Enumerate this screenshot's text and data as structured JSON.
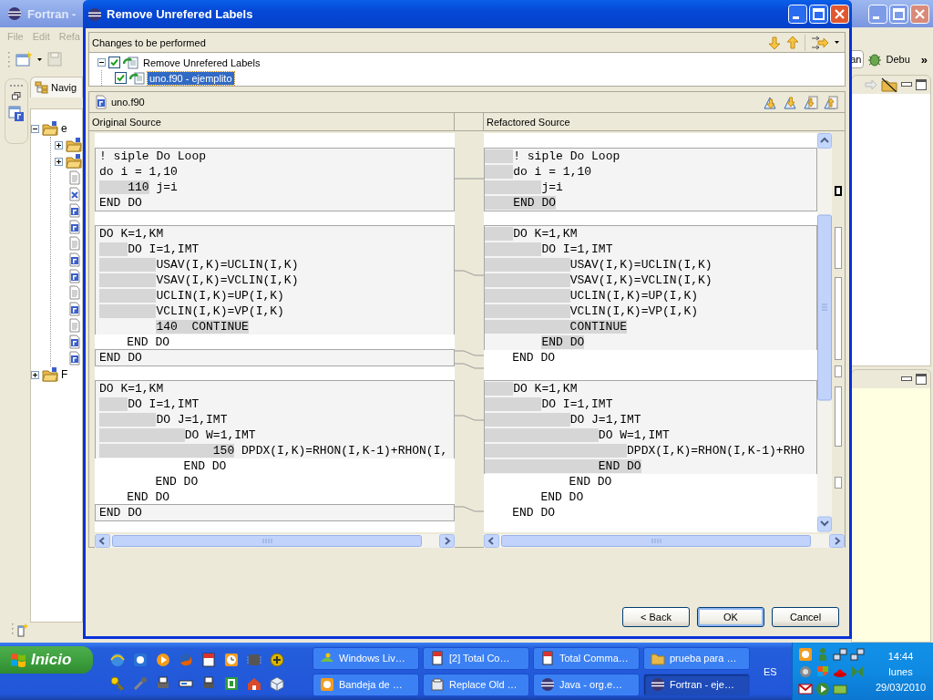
{
  "background_window": {
    "title": "Fortran -",
    "menu": [
      "File",
      "Edit",
      "Refa"
    ],
    "navigator_tab": "Navig",
    "tree": [
      {
        "label": "e",
        "expanded": true,
        "children": [
          {
            "kind": "folder",
            "expanded": false
          },
          {
            "kind": "folder",
            "expanded": false
          },
          {
            "kind": "text-file"
          },
          {
            "kind": "x-file"
          },
          {
            "kind": "fortran-file"
          },
          {
            "kind": "fortran-file"
          },
          {
            "kind": "text-file"
          },
          {
            "kind": "fortran-file"
          },
          {
            "kind": "fortran-file"
          },
          {
            "kind": "text-file"
          },
          {
            "kind": "fortran-file"
          },
          {
            "kind": "text-file"
          },
          {
            "kind": "fortran-file"
          },
          {
            "kind": "fortran-file"
          }
        ]
      },
      {
        "label": "F",
        "expanded": false
      }
    ],
    "perspectives": [
      "an",
      "Debu"
    ],
    "more": "»"
  },
  "dialog": {
    "title": "Remove Unrefered Labels",
    "changes_header": "Changes to be performed",
    "changes": [
      {
        "label": "Remove Unrefered Labels",
        "checked": true,
        "expanded": true,
        "children": [
          {
            "label": "uno.f90 - ejemplito",
            "checked": true,
            "selected": true
          }
        ]
      }
    ],
    "file": "uno.f90",
    "left_title": "Original Source",
    "right_title": "Refactored Source",
    "left": [
      {
        "kind": "gap"
      },
      {
        "kind": "changed",
        "lines": [
          {
            "text": "! siple Do Loop",
            "kind": "plain"
          },
          {
            "text": "do i = 1,10",
            "kind": "plain"
          },
          {
            "text": "    110 j=i",
            "kind": "label"
          },
          {
            "text": "END DO",
            "kind": "plain"
          }
        ]
      },
      {
        "kind": "gap"
      },
      {
        "kind": "changed",
        "lines": [
          {
            "text": "DO K=1,KM",
            "kind": "plain"
          },
          {
            "text": "    DO I=1,IMT",
            "kind": "indent"
          },
          {
            "text": "        USAV(I,K)=UCLIN(I,K)",
            "kind": "indent"
          },
          {
            "text": "        VSAV(I,K)=VCLIN(I,K)",
            "kind": "indent"
          },
          {
            "text": "        UCLIN(I,K)=UP(I,K)",
            "kind": "indent"
          },
          {
            "text": "        VCLIN(I,K)=VP(I,K)",
            "kind": "indent"
          },
          {
            "text": "        140  CONTINUE",
            "kind": "statement"
          }
        ]
      },
      {
        "kind": "unchanged",
        "lines": [
          {
            "text": "    END DO",
            "kind": "plain"
          }
        ]
      },
      {
        "kind": "changed",
        "lines": [
          {
            "text": "END DO",
            "kind": "plain"
          }
        ]
      },
      {
        "kind": "gap"
      },
      {
        "kind": "changed",
        "lines": [
          {
            "text": "DO K=1,KM",
            "kind": "plain"
          },
          {
            "text": "    DO I=1,IMT",
            "kind": "indent"
          },
          {
            "text": "        DO J=1,IMT",
            "kind": "indent"
          },
          {
            "text": "            DO W=1,IMT",
            "kind": "indent"
          },
          {
            "text": "                150 DPDX(I,K)=RHON(I,K-1)+RHON(I,",
            "kind": "label"
          }
        ]
      },
      {
        "kind": "unchanged",
        "lines": [
          {
            "text": "            END DO",
            "kind": "plain"
          },
          {
            "text": "        END DO",
            "kind": "plain"
          },
          {
            "text": "    END DO",
            "kind": "plain"
          }
        ]
      },
      {
        "kind": "changed",
        "lines": [
          {
            "text": "END DO",
            "kind": "plain"
          }
        ]
      },
      {
        "kind": "gap"
      }
    ],
    "right": [
      {
        "kind": "gap"
      },
      {
        "kind": "changed",
        "lines": [
          {
            "text": "    ! siple Do Loop",
            "kind": "indent"
          },
          {
            "text": "    do i = 1,10",
            "kind": "indent"
          },
          {
            "text": "        j=i",
            "kind": "indent"
          },
          {
            "text": "    END DO",
            "kind": "whole"
          }
        ]
      },
      {
        "kind": "gap"
      },
      {
        "kind": "changed",
        "lines": [
          {
            "text": "    DO K=1,KM",
            "kind": "indent"
          },
          {
            "text": "        DO I=1,IMT",
            "kind": "indent"
          },
          {
            "text": "            USAV(I,K)=UCLIN(I,K)",
            "kind": "indent"
          },
          {
            "text": "            VSAV(I,K)=VCLIN(I,K)",
            "kind": "indent"
          },
          {
            "text": "            UCLIN(I,K)=UP(I,K)",
            "kind": "indent"
          },
          {
            "text": "            VCLIN(I,K)=VP(I,K)",
            "kind": "indent"
          },
          {
            "text": "            CONTINUE",
            "kind": "whole"
          },
          {
            "text": "        END DO",
            "kind": "statement"
          }
        ]
      },
      {
        "kind": "unchanged",
        "lines": [
          {
            "text": "    END DO",
            "kind": "plain"
          }
        ]
      },
      {
        "kind": "gap"
      },
      {
        "kind": "changed",
        "lines": [
          {
            "text": "    DO K=1,KM",
            "kind": "indent"
          },
          {
            "text": "        DO I=1,IMT",
            "kind": "indent"
          },
          {
            "text": "            DO J=1,IMT",
            "kind": "indent"
          },
          {
            "text": "                DO W=1,IMT",
            "kind": "indent"
          },
          {
            "text": "                    DPDX(I,K)=RHON(I,K-1)+RHO",
            "kind": "indent"
          },
          {
            "text": "                END DO",
            "kind": "whole"
          }
        ]
      },
      {
        "kind": "unchanged",
        "lines": [
          {
            "text": "            END DO",
            "kind": "plain"
          },
          {
            "text": "        END DO",
            "kind": "plain"
          },
          {
            "text": "    END DO",
            "kind": "plain"
          }
        ]
      },
      {
        "kind": "gap"
      }
    ],
    "buttons": [
      {
        "label": "< Back",
        "default": false
      },
      {
        "label": "OK",
        "default": true
      },
      {
        "label": "Cancel",
        "default": false
      }
    ]
  },
  "taskbar": {
    "start": "Inicio",
    "tasks": [
      {
        "label": "Windows Liv…",
        "selected": false
      },
      {
        "label": "[2] Total Co…",
        "selected": false
      },
      {
        "label": "Total Comma…",
        "selected": false
      },
      {
        "label": "prueba para …",
        "selected": false
      },
      {
        "label": "Bandeja de …",
        "selected": false
      },
      {
        "label": "Replace Old …",
        "selected": false
      },
      {
        "label": "Java - org.e…",
        "selected": false
      },
      {
        "label": "Fortran - eje…",
        "selected": true
      }
    ],
    "language": "ES",
    "clock": {
      "time": "14:44",
      "day": "lunes",
      "date": "29/03/2010"
    }
  }
}
